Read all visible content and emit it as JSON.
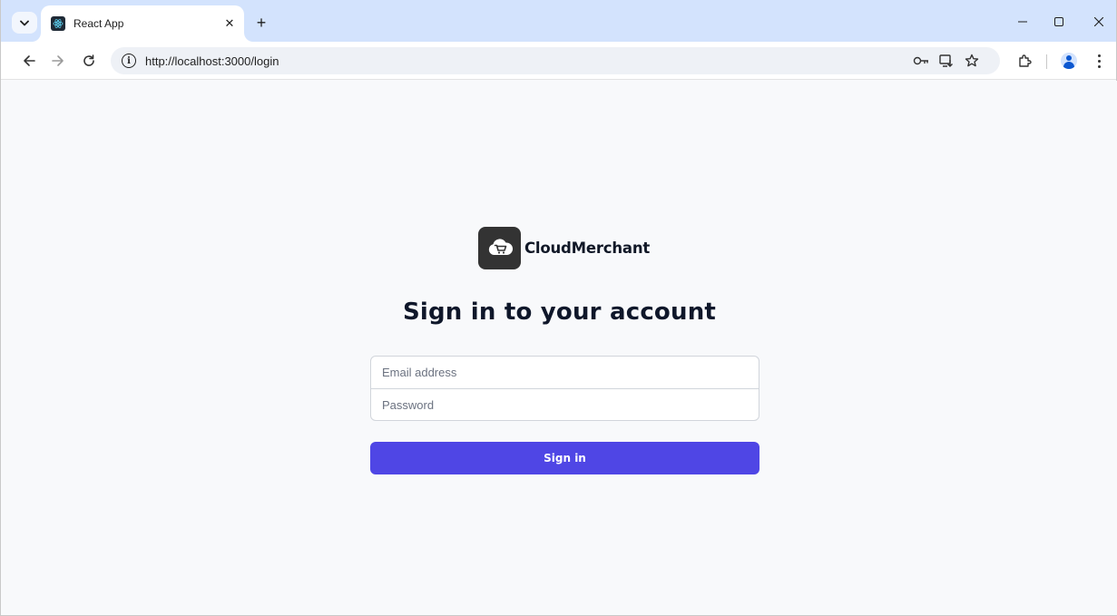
{
  "browser": {
    "tab": {
      "title": "React App",
      "close_glyph": "✕",
      "favicon": "react-icon"
    },
    "new_tab_glyph": "+",
    "window_controls": {
      "minimize": "–",
      "maximize": "☐",
      "close": "✕"
    },
    "nav": {
      "back": "←",
      "forward": "→",
      "reload": "C"
    },
    "address": {
      "url": "http://localhost:3000/login",
      "info_glyph": "i"
    },
    "toolbar_icons": [
      "password-key-icon",
      "install-app-icon",
      "bookmark-star-icon",
      "extensions-icon",
      "profile-avatar-icon",
      "menu-kebab-icon"
    ]
  },
  "login": {
    "brand_name": "CloudMerchant",
    "heading": "Sign in to your account",
    "email_placeholder": "Email address",
    "email_value": "",
    "password_placeholder": "Password",
    "password_value": "",
    "submit_label": "Sign in"
  },
  "colors": {
    "tabstrip_bg": "#d3e3fd",
    "page_bg": "#f8f9fb",
    "primary_button": "#4f46e5",
    "logo_bg": "#333333",
    "heading_text": "#0f172a"
  }
}
